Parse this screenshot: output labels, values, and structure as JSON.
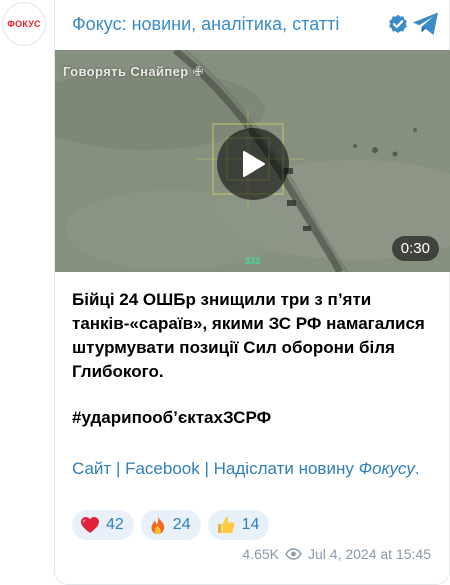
{
  "avatar": {
    "text": "ФОКУС"
  },
  "header": {
    "channel_name": "Фокус: новини, аналітика, статті",
    "verified_icon": "verified-badge-icon",
    "share_icon": "telegram-icon"
  },
  "video": {
    "watermark": "Говорять Снайпер ✙",
    "duration": "0:30",
    "hud_number": "333"
  },
  "post": {
    "text": "Бійці 24 ОШБр знищили три з п’яти танків-«сараїв», якими ЗС РФ намагалися штурмувати позиції Сил оборони біля Глибокого.",
    "hashtag": "#ударипообʼєктахЗСРФ",
    "link_site": "Сайт",
    "separator_1": " | ",
    "link_facebook": "Facebook",
    "separator_2": " | ",
    "link_submit_news_part1": "Надіслати новину ",
    "link_submit_news_part2": "Фокусу",
    "link_end": "."
  },
  "reactions": [
    {
      "icon": "heart-icon",
      "count": "42"
    },
    {
      "icon": "fire-icon",
      "count": "24"
    },
    {
      "icon": "thumbs-up-icon",
      "count": "14"
    }
  ],
  "meta": {
    "views": "4.65K",
    "views_icon": "eye-icon",
    "date": "Jul 4, 2024 at 15:45"
  },
  "colors": {
    "link": "#2f7fba",
    "channel_name": "#3a8bc6",
    "reaction_bg": "#e8f1fa",
    "meta": "#8a9aa8",
    "avatar_text": "#e3232c"
  }
}
